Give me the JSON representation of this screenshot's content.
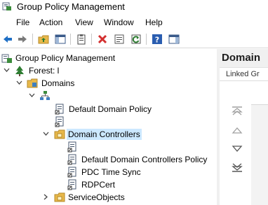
{
  "window": {
    "title": "Group Policy Management",
    "app_icon": "gpmc-app-icon"
  },
  "menu": [
    "File",
    "Action",
    "View",
    "Window",
    "Help"
  ],
  "toolbar": {
    "buttons": [
      "back-icon",
      "forward-icon",
      "up-folder-icon",
      "show-hide-tree-icon",
      "clipboard-icon",
      "delete-icon",
      "properties-icon",
      "refresh-icon",
      "help-icon",
      "show-hide-action-pane-icon"
    ]
  },
  "tree": {
    "root": "Group Policy Management",
    "forest": "Forest: l",
    "domains": "Domains",
    "domain_node": "",
    "default_domain_policy": "Default Domain Policy",
    "blank_gpo": "",
    "domain_controllers": "Domain Controllers",
    "dc_child_1": "",
    "default_dc_policy": "Default Domain Controllers Policy",
    "pdc_time_sync": "PDC Time Sync",
    "rdpcert": "RDPCert",
    "service_objects": "ServiceObjects"
  },
  "details": {
    "header": "Domain",
    "tab": "Linked Gr"
  },
  "colors": {
    "selection": "#cce8ff",
    "accent_delete": "#d32f2f",
    "folder": "#e8b84a"
  }
}
